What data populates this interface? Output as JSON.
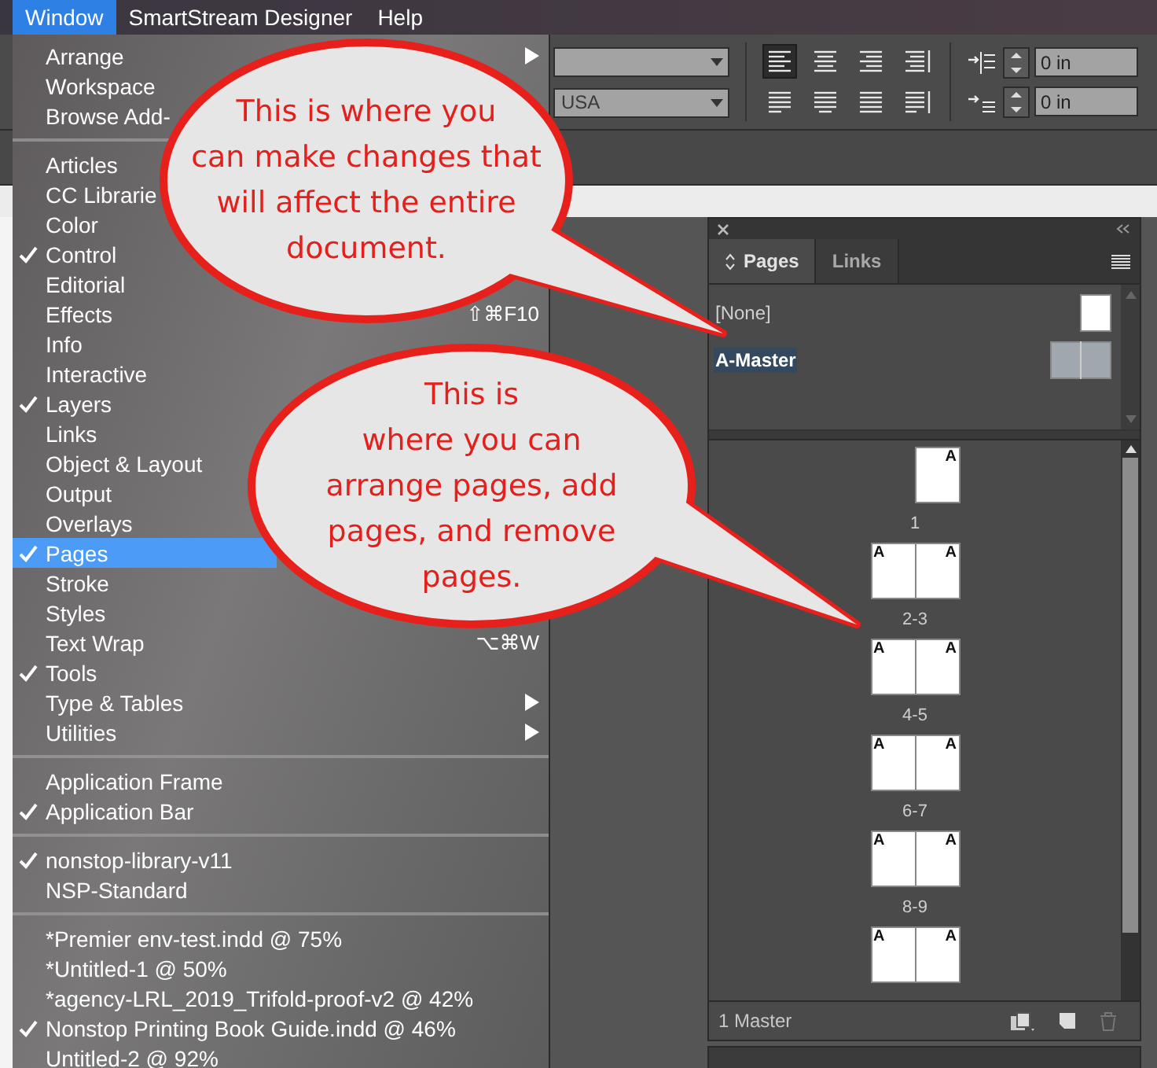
{
  "menubar": [
    {
      "label": "Window",
      "selected": true
    },
    {
      "label": "SmartStream Designer",
      "selected": false
    },
    {
      "label": "Help",
      "selected": false
    }
  ],
  "control_bar": {
    "language": "USA",
    "align_buttons": [
      {
        "kind": "left",
        "selected": true
      },
      {
        "kind": "center",
        "selected": false
      },
      {
        "kind": "right",
        "selected": false
      },
      {
        "kind": "toward-spine",
        "selected": false
      },
      {
        "kind": "justify-left",
        "selected": false
      },
      {
        "kind": "justify-center",
        "selected": false
      },
      {
        "kind": "justify-all",
        "selected": false
      },
      {
        "kind": "away-from-spine",
        "selected": false
      }
    ],
    "indent_fields": [
      {
        "kind": "left-indent",
        "value": "0 in"
      },
      {
        "kind": "first-line-indent",
        "value": "0 in"
      }
    ]
  },
  "window_menu": {
    "groups": [
      {
        "items": [
          {
            "label": "Arrange",
            "checked": false,
            "selected": false,
            "submenu": true
          },
          {
            "label": "Workspace",
            "checked": false,
            "selected": false
          },
          {
            "label": "Browse Add-",
            "checked": false,
            "selected": false
          }
        ]
      },
      {
        "items": [
          {
            "label": "Articles",
            "checked": false,
            "selected": false
          },
          {
            "label": "CC Librarie",
            "checked": false,
            "selected": false
          },
          {
            "label": "Color",
            "checked": false,
            "selected": false
          },
          {
            "label": "Control",
            "checked": true,
            "selected": false
          },
          {
            "label": "Editorial",
            "checked": false,
            "selected": false
          },
          {
            "label": "Effects",
            "checked": false,
            "selected": false,
            "shortcut": "⇧⌘F10"
          },
          {
            "label": "Info",
            "checked": false,
            "selected": false
          },
          {
            "label": "Interactive",
            "checked": false,
            "selected": false
          },
          {
            "label": "Layers",
            "checked": true,
            "selected": false
          },
          {
            "label": "Links",
            "checked": false,
            "selected": false
          },
          {
            "label": "Object & Layout",
            "checked": false,
            "selected": false
          },
          {
            "label": "Output",
            "checked": false,
            "selected": false
          },
          {
            "label": "Overlays",
            "checked": false,
            "selected": false
          },
          {
            "label": "Pages",
            "checked": true,
            "selected": true
          },
          {
            "label": "Stroke",
            "checked": false,
            "selected": false
          },
          {
            "label": "Styles",
            "checked": false,
            "selected": false
          },
          {
            "label": "Text Wrap",
            "checked": false,
            "selected": false,
            "shortcut": "⌥⌘W"
          },
          {
            "label": "Tools",
            "checked": true,
            "selected": false
          },
          {
            "label": "Type & Tables",
            "checked": false,
            "selected": false,
            "submenu": true
          },
          {
            "label": "Utilities",
            "checked": false,
            "selected": false,
            "submenu": true
          }
        ]
      },
      {
        "items": [
          {
            "label": "Application Frame",
            "checked": false,
            "selected": false
          },
          {
            "label": "Application Bar",
            "checked": true,
            "selected": false
          }
        ]
      },
      {
        "items": [
          {
            "label": "nonstop-library-v11",
            "checked": true,
            "selected": false
          },
          {
            "label": "NSP-Standard",
            "checked": false,
            "selected": false
          }
        ]
      },
      {
        "items": [
          {
            "label": "*Premier env-test.indd @ 75%",
            "checked": false,
            "selected": false
          },
          {
            "label": "*Untitled-1 @ 50%",
            "checked": false,
            "selected": false
          },
          {
            "label": "*agency-LRL_2019_Trifold-proof-v2 @ 42%",
            "checked": false,
            "selected": false
          },
          {
            "label": "Nonstop Printing Book Guide.indd @ 46%",
            "checked": true,
            "selected": false
          },
          {
            "label": "Untitled-2 @ 92%",
            "checked": false,
            "selected": false
          }
        ]
      }
    ]
  },
  "pages_panel": {
    "tabs": [
      {
        "label": "Pages",
        "selected": true
      },
      {
        "label": "Links",
        "selected": false
      }
    ],
    "masters": [
      {
        "label": "[None]",
        "kind": "single",
        "selected": false
      },
      {
        "label": "A-Master",
        "kind": "spread",
        "selected": true
      }
    ],
    "pages": [
      {
        "label": "1",
        "kind": "single",
        "masters": [
          "A"
        ]
      },
      {
        "label": "2-3",
        "kind": "spread",
        "masters": [
          "A",
          "A"
        ]
      },
      {
        "label": "4-5",
        "kind": "spread",
        "masters": [
          "A",
          "A"
        ]
      },
      {
        "label": "6-7",
        "kind": "spread",
        "masters": [
          "A",
          "A"
        ]
      },
      {
        "label": "8-9",
        "kind": "spread",
        "masters": [
          "A",
          "A"
        ]
      },
      {
        "kind": "spread",
        "masters": [
          "A",
          "A"
        ]
      }
    ],
    "footer": "1 Master"
  },
  "callouts": [
    {
      "text": "This is where you\ncan make changes that\nwill affect the entire\ndocument."
    },
    {
      "text": "This is\nwhere you can\narrange pages, add\npages, and remove\npages."
    }
  ]
}
